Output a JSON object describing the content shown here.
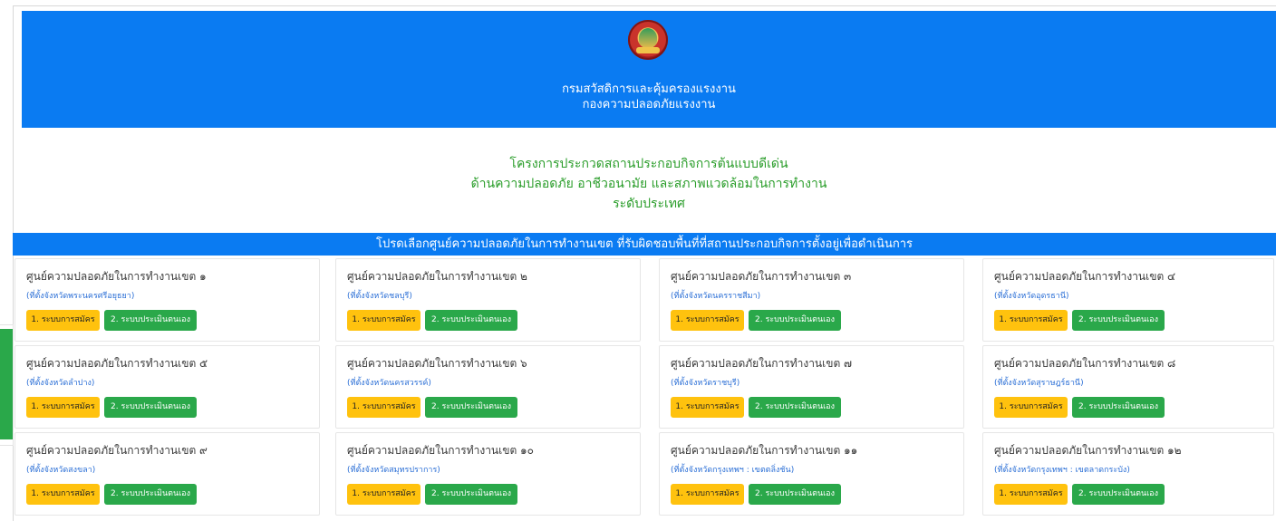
{
  "header": {
    "line1": "กรมสวัสดิการและคุ้มครองแรงงาน",
    "line2": "กองความปลอดภัยแรงงาน"
  },
  "project": {
    "line1": "โครงการประกวดสถานประกอบกิจการต้นแบบดีเด่น",
    "line2": "ด้านความปลอดภัย อาชีวอนามัย และสภาพแวดล้อมในการทำงาน",
    "line3": "ระดับประเทศ"
  },
  "banner": "โปรดเลือกศูนย์ความปลอดภัยในการทำงานเขต ที่รับผิดชอบพื้นที่ที่สถานประกอบกิจการตั้งอยู่เพื่อดำเนินการ",
  "buttons": {
    "register": "1. ระบบการสมัคร",
    "self_assess": "2. ระบบประเมินตนเอง"
  },
  "zones": [
    {
      "title": "ศูนย์ความปลอดภัยในการทำงานเขต ๑",
      "location": "(ที่ตั้งจังหวัดพระนครศรีอยุธยา)"
    },
    {
      "title": "ศูนย์ความปลอดภัยในการทำงานเขต ๒",
      "location": "(ที่ตั้งจังหวัดชลบุรี)"
    },
    {
      "title": "ศูนย์ความปลอดภัยในการทำงานเขต ๓",
      "location": "(ที่ตั้งจังหวัดนครราชสีมา)"
    },
    {
      "title": "ศูนย์ความปลอดภัยในการทำงานเขต ๔",
      "location": "(ที่ตั้งจังหวัดอุดรธานี)"
    },
    {
      "title": "ศูนย์ความปลอดภัยในการทำงานเขต ๕",
      "location": "(ที่ตั้งจังหวัดลำปาง)"
    },
    {
      "title": "ศูนย์ความปลอดภัยในการทำงานเขต ๖",
      "location": "(ที่ตั้งจังหวัดนครสวรรค์)"
    },
    {
      "title": "ศูนย์ความปลอดภัยในการทำงานเขต ๗",
      "location": "(ที่ตั้งจังหวัดราชบุรี)"
    },
    {
      "title": "ศูนย์ความปลอดภัยในการทำงานเขต ๘",
      "location": "(ที่ตั้งจังหวัดสุราษฎร์ธานี)"
    },
    {
      "title": "ศูนย์ความปลอดภัยในการทำงานเขต ๙",
      "location": "(ที่ตั้งจังหวัดสงขลา)"
    },
    {
      "title": "ศูนย์ความปลอดภัยในการทำงานเขต ๑๐",
      "location": "(ที่ตั้งจังหวัดสมุทรปราการ)"
    },
    {
      "title": "ศูนย์ความปลอดภัยในการทำงานเขต ๑๑",
      "location": "(ที่ตั้งจังหวัดกรุงเทพฯ : เขตตลิ่งชัน)"
    },
    {
      "title": "ศูนย์ความปลอดภัยในการทำงานเขต ๑๒",
      "location": "(ที่ตั้งจังหวัดกรุงเทพฯ : เขตลาดกระบัง)"
    }
  ],
  "colors": {
    "header_blue": "#0a7bf2",
    "project_green": "#2a9d2a",
    "button_yellow": "#ffc20e",
    "button_green": "#2aa84a",
    "location_blue": "#2b6fd6"
  },
  "icons": {
    "logo": "ministry-seal-icon"
  }
}
